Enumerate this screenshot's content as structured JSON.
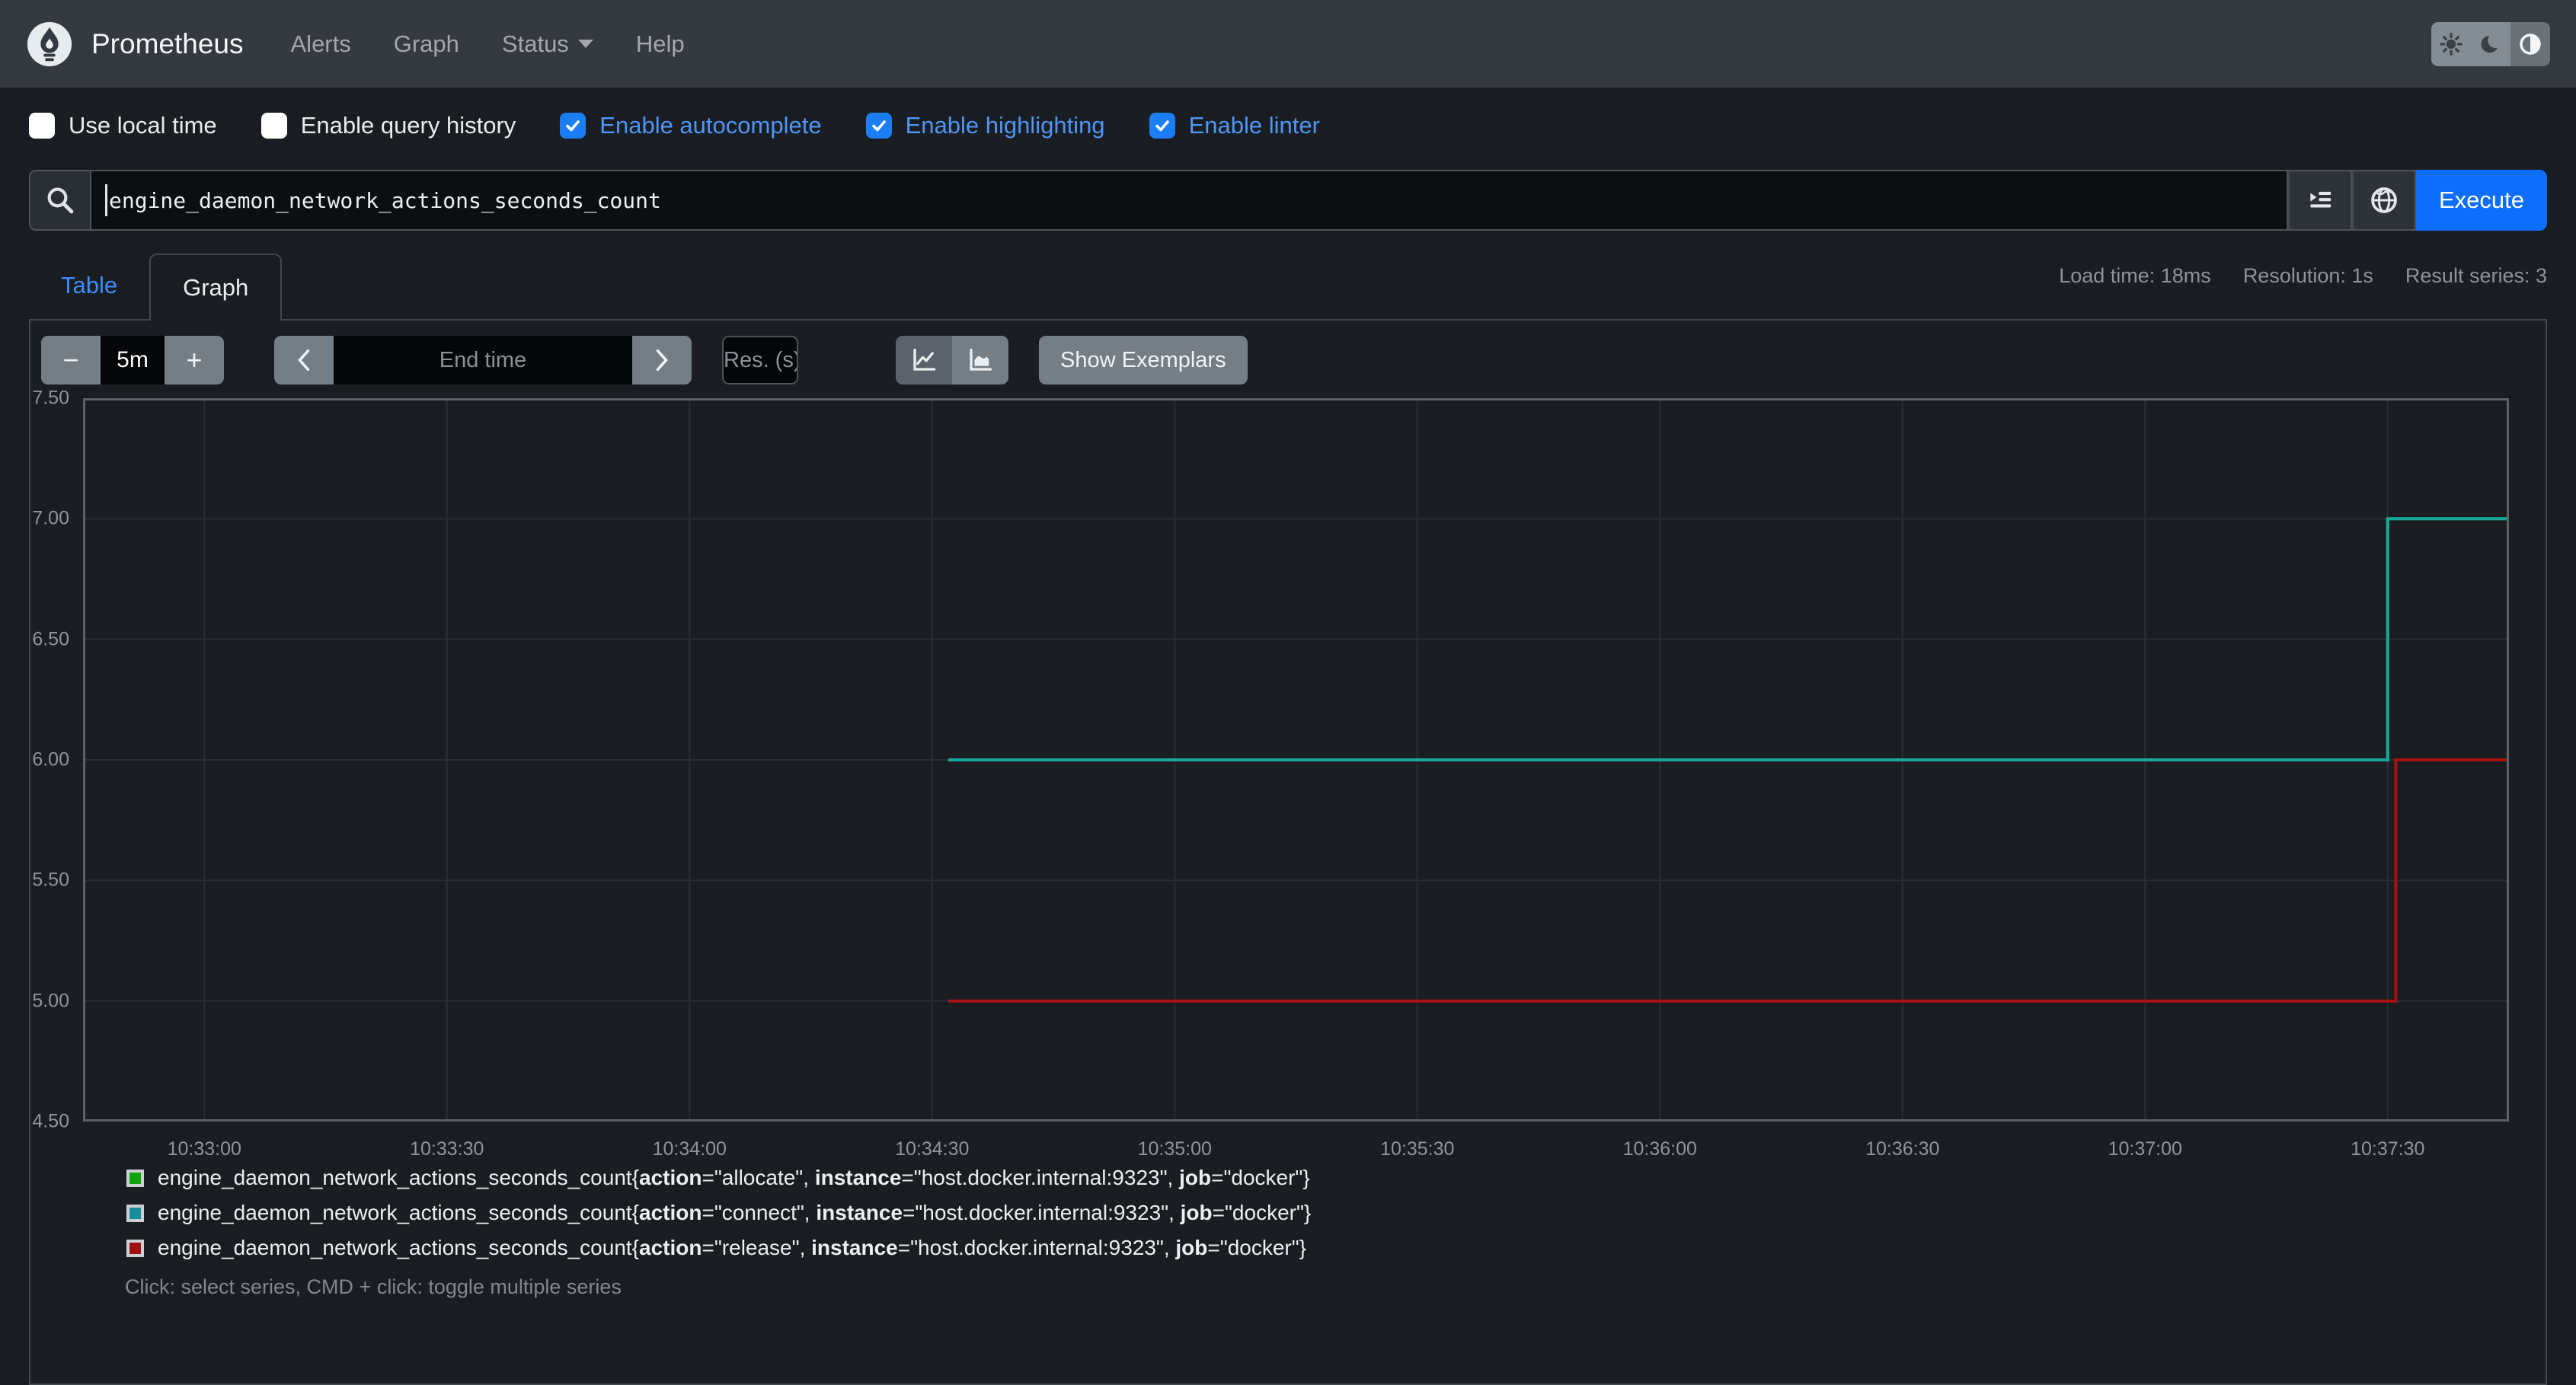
{
  "navbar": {
    "brand": "Prometheus",
    "links": [
      {
        "label": "Alerts"
      },
      {
        "label": "Graph"
      },
      {
        "label": "Status",
        "has_caret": true
      },
      {
        "label": "Help"
      }
    ],
    "theme_buttons": [
      {
        "icon": "sun-icon",
        "active": false
      },
      {
        "icon": "moon-icon",
        "active": false
      },
      {
        "icon": "circle-half-icon",
        "active": true
      }
    ]
  },
  "options": [
    {
      "label": "Use local time",
      "checked": false
    },
    {
      "label": "Enable query history",
      "checked": false
    },
    {
      "label": "Enable autocomplete",
      "checked": true
    },
    {
      "label": "Enable highlighting",
      "checked": true
    },
    {
      "label": "Enable linter",
      "checked": true
    }
  ],
  "query": {
    "value": "engine_daemon_network_actions_seconds_count",
    "execute_label": "Execute"
  },
  "icons": {
    "search": "magnifier",
    "query_tree": "indent-list",
    "metrics_explorer": "globe",
    "chart_modes": [
      "line-chart",
      "stacked-chart"
    ],
    "prev": "chevron-left",
    "next": "chevron-right"
  },
  "tabs": {
    "table": "Table",
    "graph": "Graph"
  },
  "stats": {
    "load_time": "Load time: 18ms",
    "resolution": "Resolution: 1s",
    "result_series": "Result series: 3"
  },
  "controls": {
    "minus": "−",
    "duration": "5m",
    "plus": "+",
    "end_time_placeholder": "End time",
    "res_placeholder": "Res. (s)",
    "show_exemplars": "Show Exemplars"
  },
  "chart_data": {
    "type": "line",
    "title": "",
    "xlabel": "",
    "ylabel": "",
    "grid": true,
    "legend_position": "bottom",
    "x_range": [
      "10:32:45",
      "10:37:45"
    ],
    "ylim": [
      4.5,
      7.5
    ],
    "y_ticks": [
      "7.50",
      "7.00",
      "6.50",
      "6.00",
      "5.50",
      "5.00",
      "4.50"
    ],
    "x_ticks": [
      "10:33:00",
      "10:33:30",
      "10:34:00",
      "10:34:30",
      "10:35:00",
      "10:35:30",
      "10:36:00",
      "10:36:30",
      "10:37:00",
      "10:37:30"
    ],
    "series": [
      {
        "name": "allocate",
        "color": "#0ca30c",
        "points": [
          [
            "10:34:32",
            6
          ],
          [
            "10:37:30",
            6
          ],
          [
            "10:37:30",
            7
          ],
          [
            "10:37:45",
            7
          ]
        ]
      },
      {
        "name": "connect",
        "color": "#17a89b",
        "points": [
          [
            "10:34:32",
            6
          ],
          [
            "10:37:30",
            6
          ],
          [
            "10:37:30",
            7
          ],
          [
            "10:37:45",
            7
          ]
        ]
      },
      {
        "name": "release",
        "color": "#aa1111",
        "points": [
          [
            "10:34:32",
            5
          ],
          [
            "10:37:31",
            5
          ],
          [
            "10:37:31",
            6
          ],
          [
            "10:37:45",
            6
          ]
        ]
      }
    ]
  },
  "legend": [
    {
      "color": "#0ca30c",
      "metric": "engine_daemon_network_actions_seconds_count",
      "labels": [
        {
          "name": "action",
          "value": "allocate"
        },
        {
          "name": "instance",
          "value": "host.docker.internal:9323"
        },
        {
          "name": "job",
          "value": "docker"
        }
      ]
    },
    {
      "color": "#1a8d9b",
      "metric": "engine_daemon_network_actions_seconds_count",
      "labels": [
        {
          "name": "action",
          "value": "connect"
        },
        {
          "name": "instance",
          "value": "host.docker.internal:9323"
        },
        {
          "name": "job",
          "value": "docker"
        }
      ]
    },
    {
      "color": "#9b0f0f",
      "metric": "engine_daemon_network_actions_seconds_count",
      "labels": [
        {
          "name": "action",
          "value": "release"
        },
        {
          "name": "instance",
          "value": "host.docker.internal:9323"
        },
        {
          "name": "job",
          "value": "docker"
        }
      ]
    }
  ],
  "help_text": "Click: select series, CMD + click: toggle multiple series"
}
